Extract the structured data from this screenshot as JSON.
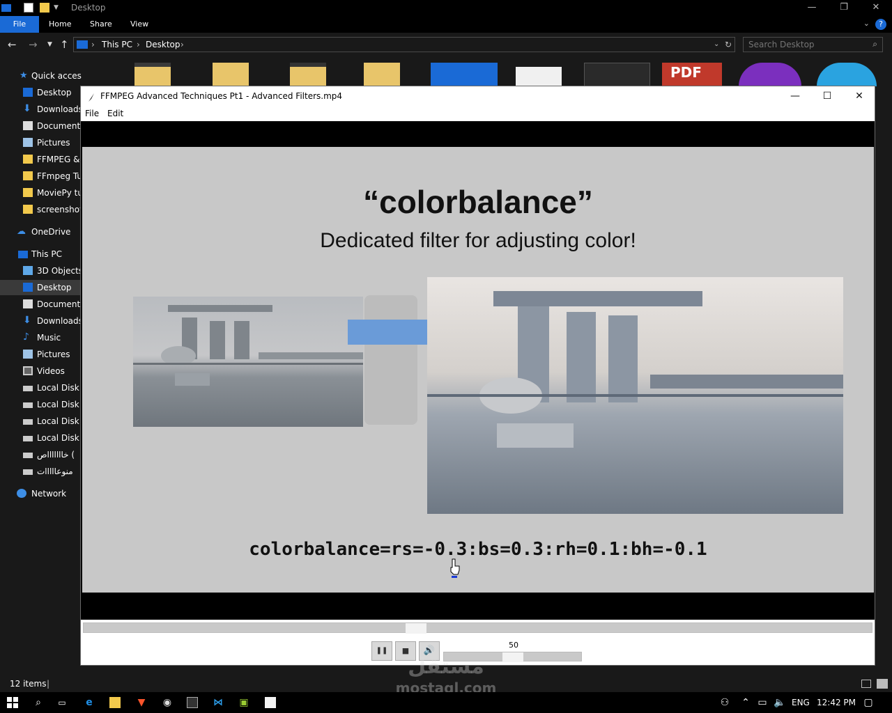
{
  "explorer": {
    "window_title": "Desktop",
    "ribbon_tabs": [
      "File",
      "Home",
      "Share",
      "View"
    ],
    "help_glyph": "?",
    "breadcrumb": [
      "This PC",
      "Desktop"
    ],
    "search_placeholder": "Search Desktop",
    "status_items": "12 items"
  },
  "sidebar": {
    "quick_access": "Quick access",
    "quick_items": [
      "Desktop",
      "Downloads",
      "Documents",
      "Pictures",
      "FFMPEG & (",
      "FFmpeg Tut",
      "MoviePy tut",
      "screenshots"
    ],
    "onedrive": "OneDrive",
    "this_pc": "This PC",
    "pc_items": [
      "3D Objects",
      "Desktop",
      "Documents",
      "Downloads",
      "Music",
      "Pictures",
      "Videos",
      "Local Disk (",
      "Local Disk (",
      "Local Disk (",
      "Local Disk (",
      "خاااااااص (",
      "منوعااااات"
    ],
    "network": "Network"
  },
  "file_icons": [
    "folder",
    "folder",
    "folder",
    "folder",
    "image",
    "word",
    "file",
    "pdf",
    "podcast",
    "telegram"
  ],
  "file_icon_pdf_label": "PDF",
  "player": {
    "title": "FFMPEG Advanced Techniques Pt1 - Advanced Filters.mp4",
    "menu": [
      "File",
      "Edit"
    ],
    "slide_title": "“colorbalance”",
    "slide_subtitle": "Dedicated filter for adjusting color!",
    "slide_code": "colorbalance=rs=-0.3:bs=0.3:rh=0.1:bh=-0.1",
    "seek_fraction": 0.42,
    "volume_value": "50",
    "volume_fraction": 0.5,
    "pause_glyph": "❚❚",
    "stop_glyph": "■",
    "mute_glyph": "🔊"
  },
  "watermark": {
    "arabic": "مستقل",
    "latin": "mostaql.com"
  },
  "taskbar": {
    "language": "ENG",
    "time": "12:42 PM"
  },
  "colors": {
    "accent": "#1a6ad6",
    "folder": "#f2c94c",
    "arrow": "#6a9bd8",
    "slide_bg": "#c8c8c8"
  }
}
